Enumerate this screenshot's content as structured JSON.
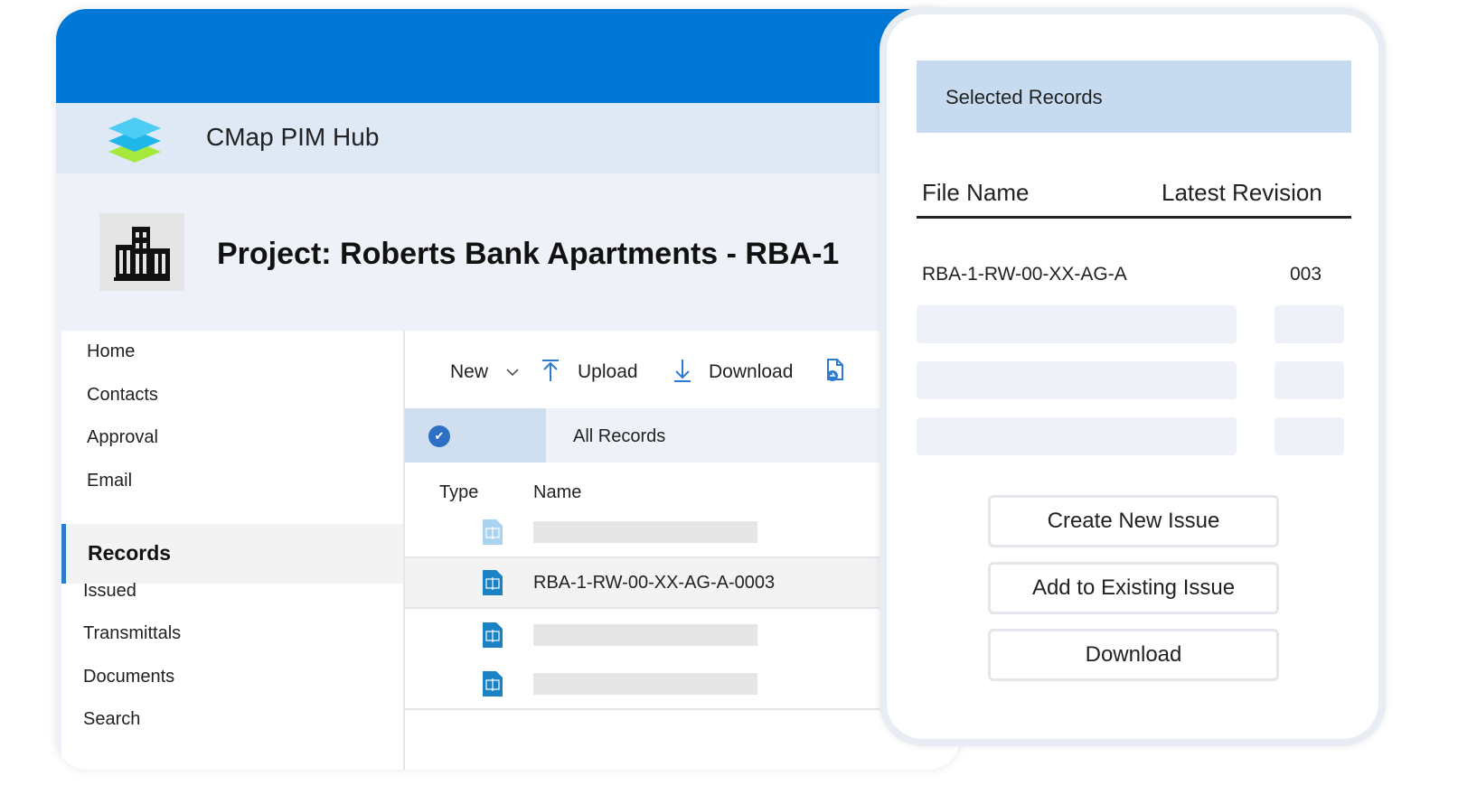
{
  "hub": {
    "title": "CMap PIM Hub"
  },
  "project": {
    "title": "Project: Roberts Bank Apartments - RBA-1"
  },
  "sidebar": {
    "items": [
      {
        "label": "Home"
      },
      {
        "label": "Contacts"
      },
      {
        "label": "Approval"
      },
      {
        "label": "Email"
      }
    ],
    "active": {
      "label": "Records"
    },
    "sub_items": [
      {
        "label": "Issued"
      },
      {
        "label": "Transmittals"
      },
      {
        "label": "Documents"
      },
      {
        "label": "Search"
      }
    ]
  },
  "toolbar": {
    "new_label": "New",
    "upload_label": "Upload",
    "download_label": "Download"
  },
  "records": {
    "filter_label": "All Records",
    "columns": {
      "type": "Type",
      "name": "Name"
    },
    "rows": [
      {
        "name": ""
      },
      {
        "name": "RBA-1-RW-00-XX-AG-A-0003"
      },
      {
        "name": ""
      },
      {
        "name": ""
      }
    ]
  },
  "panel": {
    "title": "Selected Records",
    "columns": {
      "file_name": "File Name",
      "latest_revision": "Latest Revision"
    },
    "selected": {
      "file_name": "RBA-1-RW-00-XX-AG-A",
      "revision": "003"
    },
    "actions": {
      "create": "Create New Issue",
      "add": "Add to Existing Issue",
      "download": "Download"
    }
  },
  "colors": {
    "brand_blue": "#0078d7",
    "accent_blue": "#2d7bd0",
    "header_tint": "#dfe9f5",
    "panel_head": "#c7dbf0"
  },
  "icons": [
    "layers-logo-icon",
    "building-icon",
    "chevron-down-icon",
    "upload-icon",
    "download-icon",
    "document-sync-icon",
    "check-icon",
    "file-icon"
  ]
}
